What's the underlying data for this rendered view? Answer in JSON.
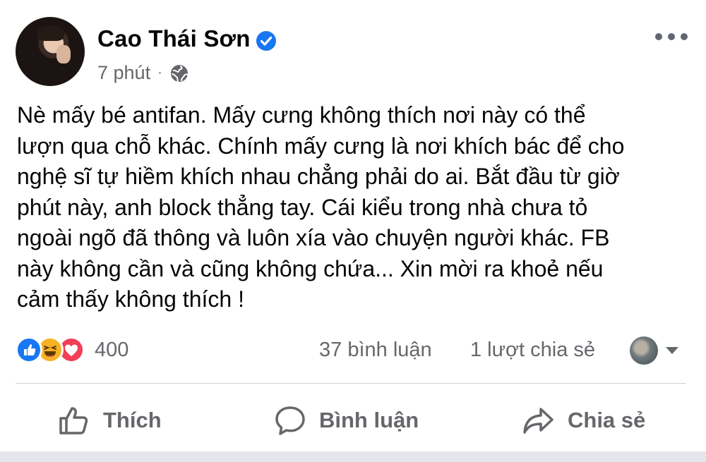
{
  "author": {
    "name": "Cao Thái Sơn",
    "verified": true,
    "timestamp": "7 phút",
    "separator": "·",
    "privacy_icon": "globe-icon"
  },
  "post": {
    "lines": [
      "Nè mấy bé antifan. Mấy cưng không thích nơi này có thể",
      "lượn qua chỗ khác. Chính mấy cưng là nơi khích bác để cho",
      "nghệ sĩ tự hiềm khích nhau chẳng phải do ai. Bắt đầu từ giờ",
      "phút này, anh block thẳng tay. Cái kiểu trong nhà chưa tỏ",
      "ngoài ngõ đã thông và luôn xía vào chuyện người khác. FB",
      "này không cần và cũng không chứa... Xin mời ra khoẻ nếu",
      "cảm thấy không thích !"
    ]
  },
  "stats": {
    "reaction_icons": [
      "like-icon",
      "haha-icon",
      "love-icon"
    ],
    "reaction_count": "400",
    "comments": "37 bình luận",
    "shares": "1 lượt chia sẻ"
  },
  "actions": {
    "like": "Thích",
    "comment": "Bình luận",
    "share": "Chia sẻ"
  },
  "colors": {
    "text": "#050505",
    "secondary_text": "#65676b",
    "like_blue": "#1877f2",
    "haha_yellow": "#f7b125",
    "love_red": "#f33e58",
    "verified_blue": "#1877f2"
  }
}
